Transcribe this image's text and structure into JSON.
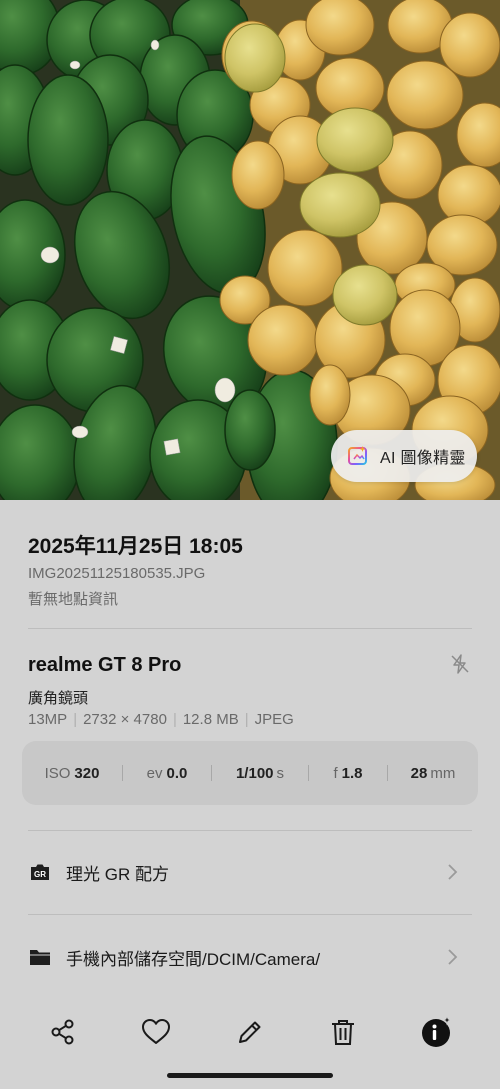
{
  "photo": {
    "ai_button": {
      "label": "AI 圖像精靈",
      "icon": "ai-sparkle-icon"
    }
  },
  "info": {
    "datetime": "2025年11月25日 18:05",
    "filename": "IMG20251125180535.JPG",
    "location": "暫無地點資訊"
  },
  "camera": {
    "device": "realme GT 8 Pro",
    "flash_icon": "flash-off-icon",
    "lens": "廣角鏡頭",
    "specs": [
      "13MP",
      "2732 × 4780",
      "12.8 MB",
      "JPEG"
    ]
  },
  "exif": [
    {
      "key": "ISO",
      "value": "320",
      "unit": ""
    },
    {
      "key": "ev",
      "value": "0.0",
      "unit": ""
    },
    {
      "key": "",
      "value": "1/100",
      "unit": "s"
    },
    {
      "key": "f",
      "value": "1.8",
      "unit": ""
    },
    {
      "key": "",
      "value": "28",
      "unit": "mm"
    }
  ],
  "rows": {
    "recipe": {
      "label": "理光 GR 配方",
      "icon": "gr-icon"
    },
    "storage": {
      "label": "手機內部儲存空間/DCIM/Camera/",
      "icon": "folder-icon"
    }
  },
  "toolbar": {
    "share": "share-icon",
    "favorite": "heart-icon",
    "edit": "pencil-icon",
    "delete": "trash-icon",
    "info": "info-sparkle-icon"
  },
  "colors": {
    "panel_bg": "#d3d3d3",
    "exif_bg": "#c8c8c8",
    "avocado": "#2f6b2e",
    "mango": "#e2b84f"
  }
}
